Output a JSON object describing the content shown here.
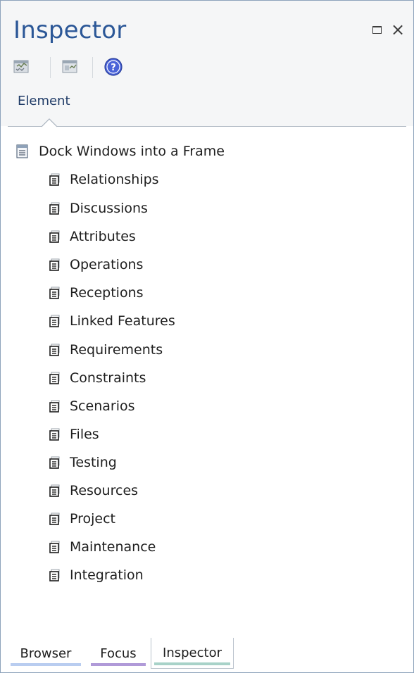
{
  "window": {
    "title": "Inspector",
    "maximize_glyph": "",
    "close_glyph": "×"
  },
  "toolbar": {
    "buttons": [
      {
        "icon": "filter-checklist-icon"
      },
      {
        "icon": "window-layout-icon"
      },
      {
        "icon": "help-icon"
      }
    ]
  },
  "tabs": {
    "active": "Element"
  },
  "tree": {
    "root": "Dock Windows into a Frame",
    "items": [
      "Relationships",
      "Discussions",
      "Attributes",
      "Operations",
      "Receptions",
      "Linked Features",
      "Requirements",
      "Constraints",
      "Scenarios",
      "Files",
      "Testing",
      "Resources",
      "Project",
      "Maintenance",
      "Integration"
    ]
  },
  "bottom_tabs": [
    {
      "label": "Browser",
      "color": "#b9cdf0"
    },
    {
      "label": "Focus",
      "color": "#b09ad8"
    },
    {
      "label": "Inspector",
      "color": "#a8d2c8",
      "active": true
    }
  ],
  "colors": {
    "title": "#2b5797",
    "border": "#8da2bb",
    "help_blue": "#3a56c8"
  }
}
